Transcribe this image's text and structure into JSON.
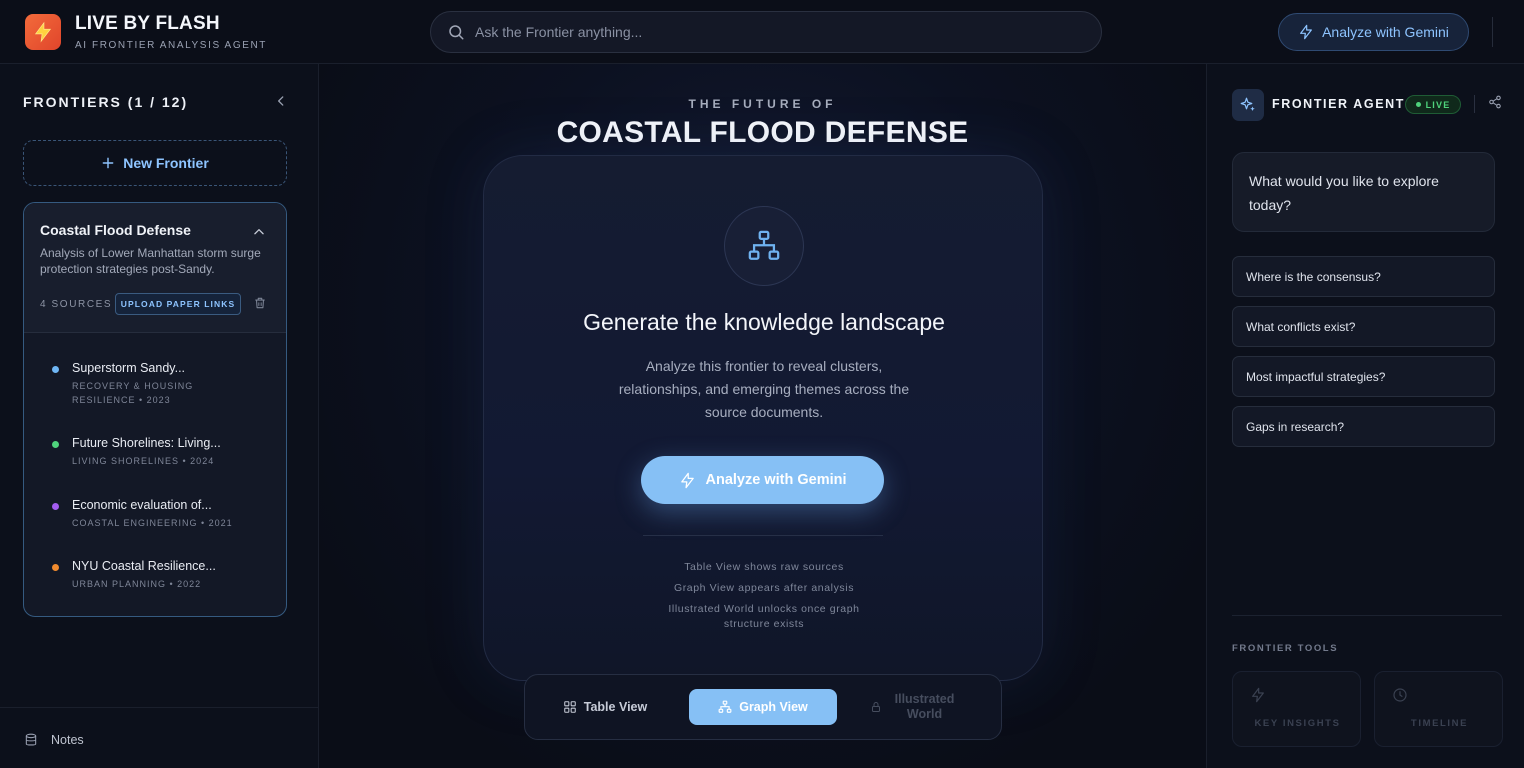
{
  "header": {
    "brand_name": "LIVE BY FLASH",
    "brand_subtitle": "AI FRONTIER ANALYSIS AGENT",
    "search_placeholder": "Ask the Frontier anything...",
    "analyze_label": "Analyze with Gemini"
  },
  "sidebar": {
    "title": "FRONTIERS (1 / 12)",
    "new_frontier_label": "New Frontier",
    "frontier": {
      "title": "Coastal Flood Defense",
      "description": "Analysis of Lower Manhattan storm surge protection strategies post-Sandy.",
      "sources_label": "4 SOURCES",
      "upload_label": "UPLOAD PAPER LINKS",
      "sources": [
        {
          "title": "Superstorm Sandy...",
          "meta": "RECOVERY & HOUSING RESILIENCE • 2023",
          "color": "#6fb6f5"
        },
        {
          "title": "Future Shorelines: Living...",
          "meta": "LIVING SHORELINES • 2024",
          "color": "#4fd37c"
        },
        {
          "title": "Economic evaluation of...",
          "meta": "COASTAL ENGINEERING • 2021",
          "color": "#a35cf0"
        },
        {
          "title": "NYU Coastal Resilience...",
          "meta": "URBAN PLANNING • 2022",
          "color": "#f08a2e"
        }
      ]
    },
    "notes_label": "Notes"
  },
  "main": {
    "kicker": "THE FUTURE OF",
    "headline": "COASTAL FLOOD DEFENSE",
    "panel": {
      "title": "Generate the knowledge landscape",
      "description": "Analyze this frontier to reveal clusters, relationships, and emerging themes across the source documents.",
      "button_label": "Analyze with Gemini",
      "hints": [
        "Table View shows raw sources",
        "Graph View appears after analysis",
        "Illustrated World unlocks once graph structure exists"
      ]
    },
    "views": {
      "table": "Table View",
      "graph": "Graph View",
      "world": "Illustrated World",
      "active": "Graph View"
    }
  },
  "agent": {
    "title": "FRONTIER AGENT",
    "status": "LIVE",
    "greeting": "What would you like to explore today?",
    "suggestions": [
      "Where is the consensus?",
      "What conflicts exist?",
      "Most impactful strategies?",
      "Gaps in research?"
    ],
    "tools_title": "FRONTIER TOOLS",
    "tools": [
      {
        "label": "KEY INSIGHTS",
        "icon": "lightning-icon"
      },
      {
        "label": "TIMELINE",
        "icon": "clock-icon"
      }
    ]
  },
  "colors": {
    "accent": "#86c0f5",
    "accent_text": "#8ec4ff",
    "brand": "#e0452b",
    "live": "#4fd37c"
  }
}
